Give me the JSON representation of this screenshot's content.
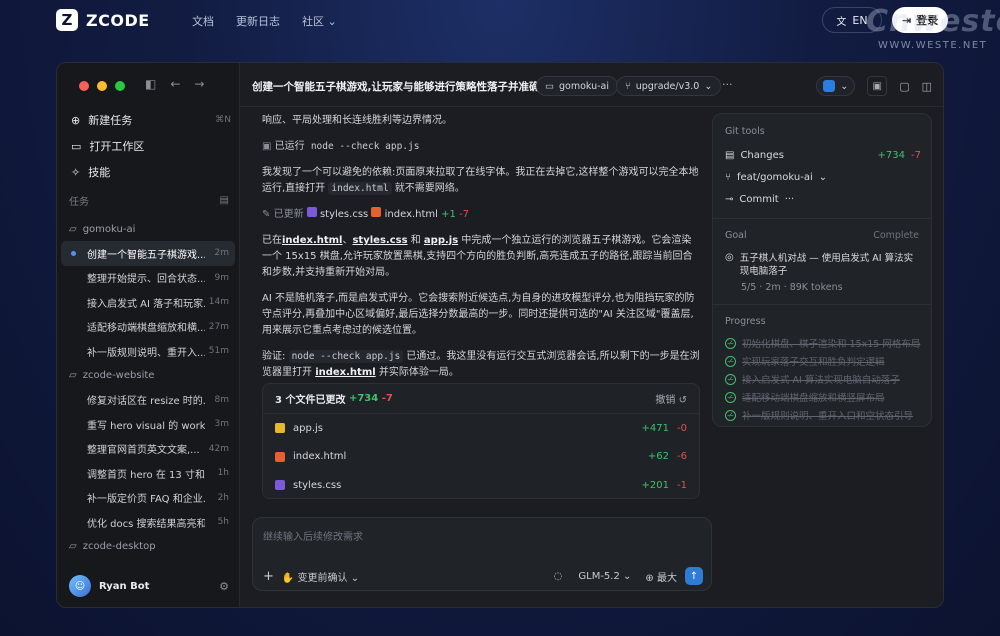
{
  "nav": {
    "brand": "ZCODE",
    "links": [
      "文档",
      "更新日志",
      "社区"
    ],
    "lang_label": "EN",
    "login_label": "登录"
  },
  "watermark": {
    "main": "Cnweste",
    "url": "WWW.WESTE.NET"
  },
  "sidebar": {
    "menu": [
      {
        "label": "新建任务",
        "shortcut": "⌘N",
        "icon": "new-task-icon"
      },
      {
        "label": "打开工作区",
        "shortcut": "",
        "icon": "folder-open-icon"
      },
      {
        "label": "技能",
        "shortcut": "",
        "icon": "wand-icon"
      }
    ],
    "tasks_label": "任务",
    "groups": [
      {
        "name": "gomoku-ai",
        "tasks": [
          {
            "title": "创建一个智能五子棋游戏...",
            "time": "2m",
            "active": true
          },
          {
            "title": "整理开始提示、回合状态...",
            "time": "9m"
          },
          {
            "title": "接入启发式 AI 落子和玩家...",
            "time": "14m"
          },
          {
            "title": "适配移动端棋盘缩放和横...",
            "time": "27m"
          },
          {
            "title": "补一版规则说明、重开入...",
            "time": "51m"
          }
        ]
      },
      {
        "name": "zcode-website",
        "tasks": [
          {
            "title": "修复对话区在 resize 时的...",
            "time": "8m"
          },
          {
            "title": "重写 hero visual 的 works...",
            "time": "3m"
          },
          {
            "title": "整理官网首页英文文案,...",
            "time": "42m"
          },
          {
            "title": "调整首页 hero 在 13 寸和移...",
            "time": "1h"
          },
          {
            "title": "补一版定价页 FAQ 和企业...",
            "time": "2h"
          },
          {
            "title": "优化 docs 搜索结果高亮和...",
            "time": "5h"
          }
        ]
      },
      {
        "name": "zcode-desktop",
        "tasks": []
      }
    ],
    "user": {
      "name": "Ryan Bot"
    }
  },
  "header": {
    "title": "创建一个智能五子棋游戏,让玩家与能够进行策略性落子并准确判断...",
    "repo": "gomoku-ai",
    "branch": "upgrade/v3.0"
  },
  "message": {
    "line0": "响应、平局处理和长连线胜利等边界情况。",
    "ran_label": "已运行",
    "ran_cmd": "node --check app.js",
    "p1_a": "我发现了一个可以避免的依赖:页面原来拉取了在线字体。我正在去掉它,这样整个游戏可以完全本地运行,直接打开",
    "p1_code": "index.html",
    "p1_b": "就不需要网络。",
    "updated_label": "已更新",
    "updated_file1": "styles.css",
    "updated_file2": "index.html",
    "updated_add": "+1",
    "updated_del": "-7",
    "p2_f1": "index.html",
    "p2_sep1": "、",
    "p2_f2": "styles.css",
    "p2_sep2": "和",
    "p2_f3": "app.js",
    "p2_rest": "中完成一个独立运行的浏览器五子棋游戏。它会渲染一个 15x15 棋盘,允许玩家放置黑棋,支持四个方向的胜负判断,高亮连成五子的路径,跟踪当前回合和步数,并支持重新开始对局。",
    "p2_pre": "已在",
    "p3": "AI 不是随机落子,而是启发式评分。它会搜索附近候选点,为自身的进攻模型评分,也为阻挡玩家的防守点评分,再叠加中心区域偏好,最后选择分数最高的一步。同时还提供可选的\"AI 关注区域\"覆盖层,用来展示它重点考虑过的候选位置。",
    "p4_a": "验证:",
    "p4_code": "node --check app.js",
    "p4_b": "已通过。我这里没有运行交互式浏览器会话,所以剩下的一步是在浏览器里打开",
    "p4_link": "index.html",
    "p4_c": "并实际体验一局。"
  },
  "changes": {
    "title": "3 个文件已更改",
    "add": "+734",
    "del": "-7",
    "undo_label": "撤销",
    "files": [
      {
        "name": "app.js",
        "add": "+471",
        "del": "-0",
        "color": "#e8b730"
      },
      {
        "name": "index.html",
        "add": "+62",
        "del": "-6",
        "color": "#e2622f"
      },
      {
        "name": "styles.css",
        "add": "+201",
        "del": "-1",
        "color": "#7a5ad8"
      }
    ]
  },
  "composer": {
    "placeholder": "继续输入后续修改需求",
    "approve_label": "变更前确认",
    "model": "GLM-5.2",
    "effort": "最大"
  },
  "panel": {
    "git_label": "Git tools",
    "changes_label": "Changes",
    "changes_add": "+734",
    "changes_del": "-7",
    "branch": "feat/gomoku-ai",
    "commit_label": "Commit",
    "goal_label": "Goal",
    "goal_status": "Complete",
    "goal_title": "五子棋人机对战 — 使用启发式 AI 算法实现电脑落子",
    "goal_meta": "5/5 · 2m · 89K tokens",
    "progress_label": "Progress",
    "progress": [
      "初始化棋盘、棋子渲染和 15x15 网格布局",
      "实现玩家落子交互和胜负判定逻辑",
      "接入启发式 AI 算法实现电脑自动落子",
      "适配移动端棋盘缩放和横竖屏布局",
      "补一版规则说明、重开入口和空状态引导"
    ]
  },
  "colors": {
    "accent": "#2f7cd6",
    "add": "#3fc16b",
    "del": "#e35050"
  }
}
